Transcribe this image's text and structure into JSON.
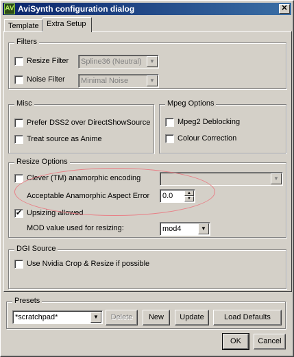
{
  "window": {
    "title": "AviSynth configuration dialog",
    "app_icon": "avisynth-icon",
    "close_glyph": "✕"
  },
  "tabs": [
    {
      "label": "Template"
    },
    {
      "label": "Extra Setup"
    }
  ],
  "filters": {
    "legend": "Filters",
    "resize": {
      "label": "Resize Filter",
      "checked": false,
      "value": "Spline36 (Neutral)"
    },
    "noise": {
      "label": "Noise Filter",
      "checked": false,
      "value": "Minimal Noise"
    }
  },
  "misc": {
    "legend": "Misc",
    "prefer_dss2": {
      "label": "Prefer DSS2 over DirectShowSource",
      "checked": false
    },
    "anime": {
      "label": "Treat source as Anime",
      "checked": false
    }
  },
  "mpeg": {
    "legend": "Mpeg Options",
    "deblocking": {
      "label": "Mpeg2 Deblocking",
      "checked": false
    },
    "colour": {
      "label": "Colour Correction",
      "checked": false
    }
  },
  "resize_options": {
    "legend": "Resize Options",
    "clever": {
      "label": "Clever (TM) anamorphic encoding",
      "checked": false,
      "value": ""
    },
    "aspect_error": {
      "label": "Acceptable Anamorphic Aspect Error",
      "value": "0.0"
    },
    "upsizing": {
      "label": "Upsizing allowed",
      "checked": true
    },
    "mod": {
      "label": "MOD value used for resizing:",
      "value": "mod4"
    }
  },
  "dgi": {
    "legend": "DGI Source",
    "nvidia": {
      "label": "Use Nvidia Crop & Resize if possible",
      "checked": false
    }
  },
  "presets": {
    "legend": "Presets",
    "value": "*scratchpad*",
    "delete": "Delete",
    "new": "New",
    "update": "Update",
    "load_defaults": "Load Defaults"
  },
  "footer": {
    "ok": "OK",
    "cancel": "Cancel"
  },
  "glyphs": {
    "check": "✔",
    "arrow_down": "▼",
    "arrow_up": "▲"
  },
  "colors": {
    "title_start": "#0a246a",
    "title_end": "#3a6ea5",
    "annotation_oval": "#e87f86"
  }
}
